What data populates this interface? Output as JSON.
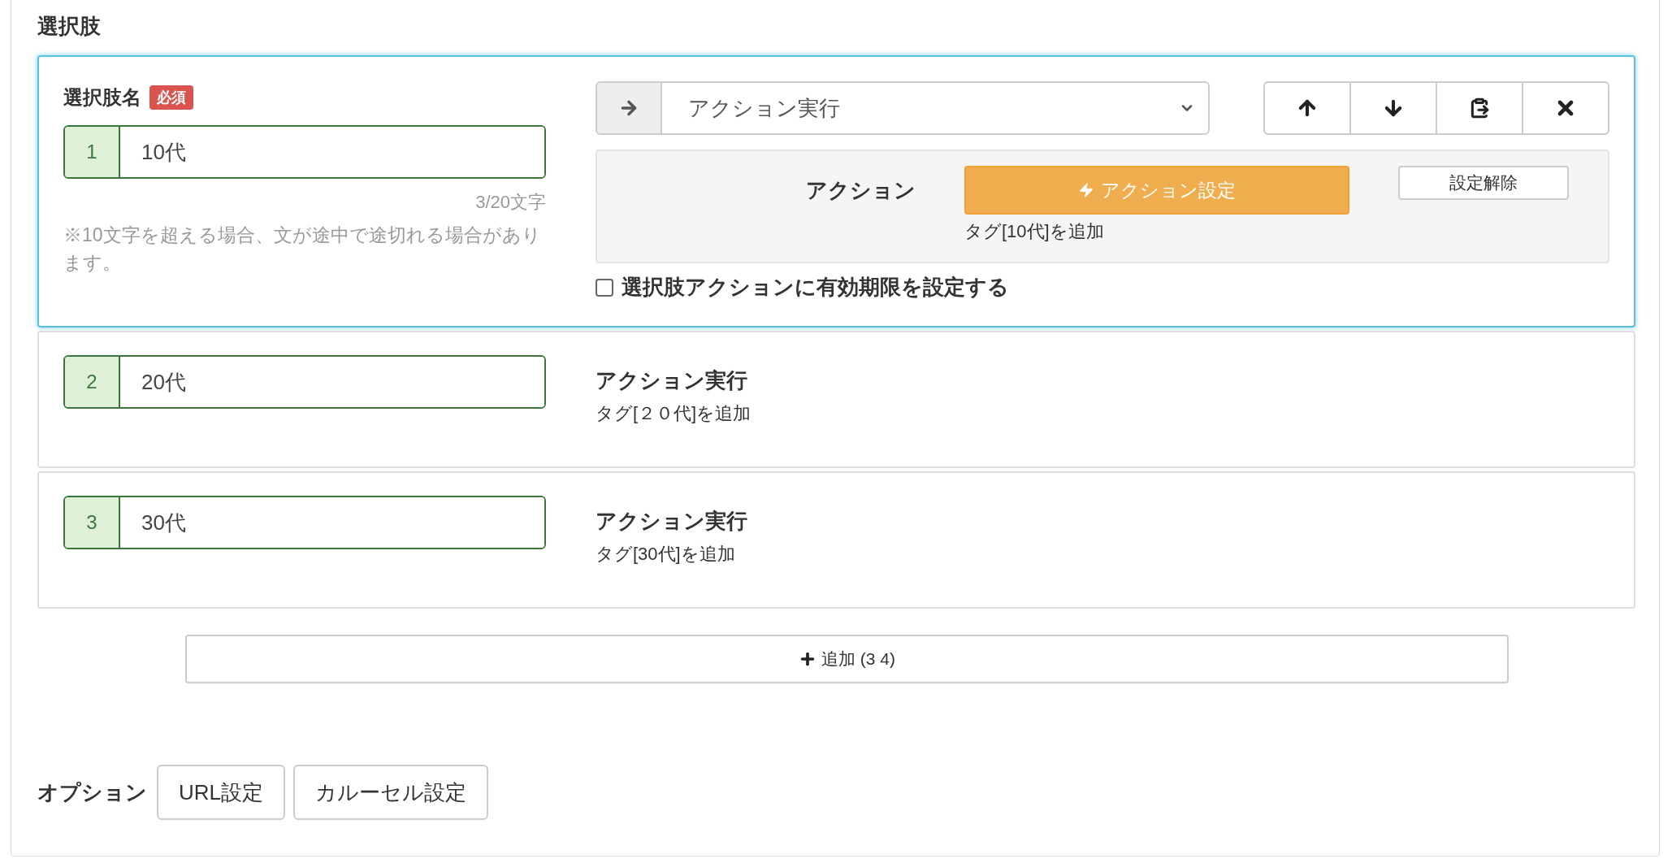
{
  "section_title": "選択肢",
  "choices": [
    {
      "expanded": true,
      "number": "1",
      "value": "10代",
      "label": "選択肢名",
      "required_badge": "必須",
      "counter": "3/20文字",
      "note": "※10文字を超える場合、文が途中で途切れる場合があります。",
      "action_select": "アクション実行",
      "action_label": "アクション",
      "action_button": "アクション設定",
      "clear_button": "設定解除",
      "action_description": "タグ[10代]を追加",
      "expiry": {
        "label": "選択肢アクションに有効期限を設定する",
        "checked": false
      }
    },
    {
      "expanded": false,
      "number": "2",
      "value": "20代",
      "action_title": "アクション実行",
      "action_description": "タグ[２０代]を追加"
    },
    {
      "expanded": false,
      "number": "3",
      "value": "30代",
      "action_title": "アクション実行",
      "action_description": "タグ[30代]を追加"
    }
  ],
  "add_button": "追加 (3 4)",
  "options": {
    "label": "オプション",
    "buttons": [
      "URL設定",
      "カルーセル設定"
    ]
  }
}
